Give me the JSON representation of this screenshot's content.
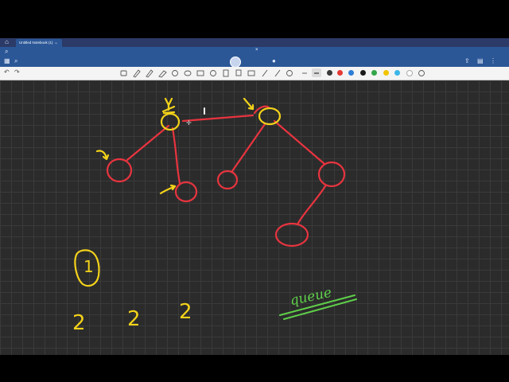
{
  "tab": {
    "title": "Untitled Notebook (1)",
    "close": "×",
    "dropdown": "⌄"
  },
  "appbar": {
    "close": "×"
  },
  "icons": {
    "home": "⌂",
    "search": "⌕",
    "grid": "▦",
    "share": "⇪",
    "pages": "▤",
    "more": "⋮",
    "undo": "↶",
    "redo": "↷",
    "mic": "🎤"
  },
  "canvas_text": {
    "heading": "queue",
    "count": "1",
    "values": [
      "2",
      "2",
      "2"
    ]
  },
  "colors": {
    "tree_red": "#e8343f",
    "highlight_yellow": "#f3d21a",
    "queue_green": "#5fd04a",
    "canvas_bg": "#2b2b2b",
    "header_blue": "#2b5797",
    "swatches": [
      "#3a3a3a",
      "#e53935",
      "#2e7dd6",
      "#1a1a1a",
      "#33a64a",
      "#f2c400",
      "#3cb6e8",
      "#ffffff"
    ]
  },
  "toolbar": {
    "tools": [
      "select",
      "pen",
      "highlighter",
      "eraser",
      "lasso",
      "shapes",
      "image",
      "text",
      "laser",
      "stickers",
      "ruler",
      "timer"
    ],
    "stroke_sizes": [
      "—",
      "—"
    ]
  }
}
